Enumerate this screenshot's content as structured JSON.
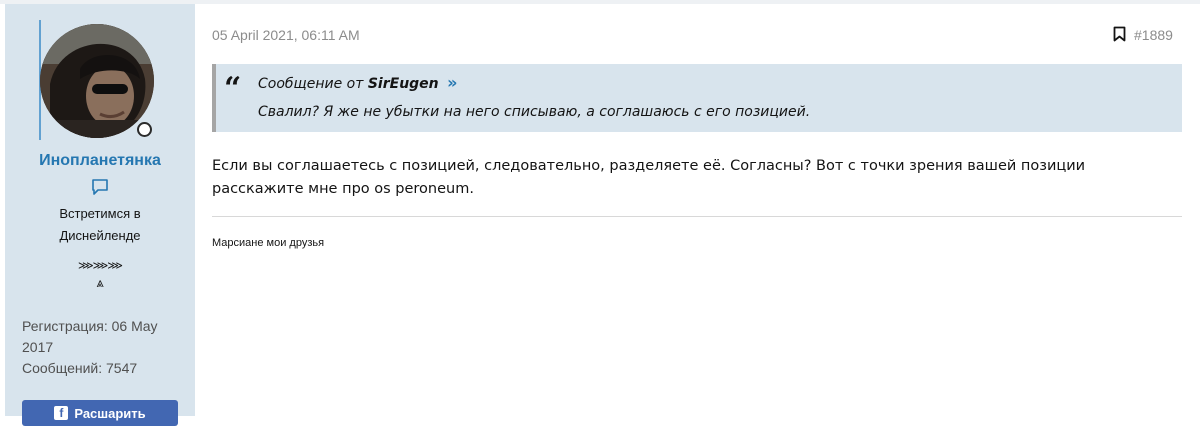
{
  "user": {
    "avatar_alt": "user-avatar",
    "name": "Инопланетянка",
    "title": "Встретимся в Диснейленде",
    "banner_line1": "⋙⋙⋙",
    "banner_line2": "⩓",
    "registration_label": "Регистрация:",
    "registration_value": "06 May 2017",
    "posts_label": "Сообщений:",
    "posts_value": "7547",
    "share_label": "Расшарить"
  },
  "post": {
    "date": "05 April 2021, 06:11 AM",
    "number": "#1889",
    "quote": {
      "prefix": "Сообщение от",
      "author": "SirEugen",
      "jump_glyph": "»",
      "text": "Свалил? Я же не убытки на него списываю, а соглашаюсь с его позицией."
    },
    "body": "Если вы соглашаетесь с позицией, следовательно, разделяете её. Согласны? Вот с точки зрения вашей позиции расскажите мне про os peroneum.",
    "signature": "Марсиане мои друзья"
  },
  "colors": {
    "panel_bg": "#d8e4ed",
    "username": "#2577b1",
    "muted": "#8c8c8c",
    "facebook": "#4267b2"
  }
}
